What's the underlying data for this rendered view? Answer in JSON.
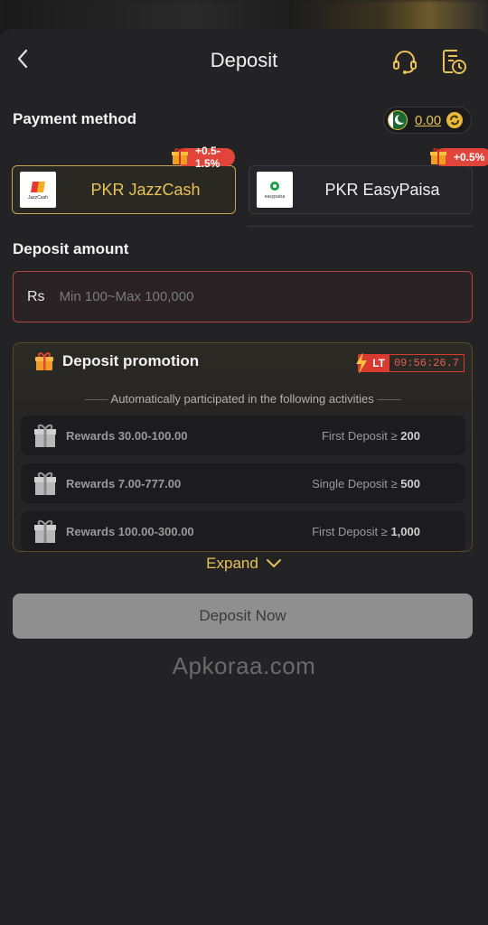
{
  "header": {
    "title": "Deposit"
  },
  "payment": {
    "section_label": "Payment method",
    "balance": "0.00",
    "methods": [
      {
        "name": "PKR JazzCash",
        "bonus": "+0.5-1.5%",
        "logo_text": "JazzCash",
        "selected": true
      },
      {
        "name": "PKR EasyPaisa",
        "bonus": "+0.5%",
        "logo_text": "easypaisa",
        "selected": false
      }
    ]
  },
  "amount": {
    "section_label": "Deposit amount",
    "currency": "Rs",
    "placeholder": "Min 100~Max 100,000"
  },
  "promotion": {
    "title": "Deposit promotion",
    "timer_tag": "LT",
    "timer": "09:56:26.7",
    "note": "Automatically participated in the following activities",
    "rows": [
      {
        "reward": "Rewards 30.00-100.00",
        "condition": "First Deposit ≥",
        "amount": "200"
      },
      {
        "reward": "Rewards 7.00-777.00",
        "condition": "Single Deposit ≥",
        "amount": "500"
      },
      {
        "reward": "Rewards 100.00-300.00",
        "condition": "First Deposit ≥",
        "amount": "1,000"
      }
    ]
  },
  "expand_label": "Expand",
  "deposit_button": "Deposit Now",
  "watermark": "Apkoraa.com",
  "colors": {
    "accent_gold": "#e8c257",
    "badge_red": "#e0443a",
    "background": "#232325"
  }
}
